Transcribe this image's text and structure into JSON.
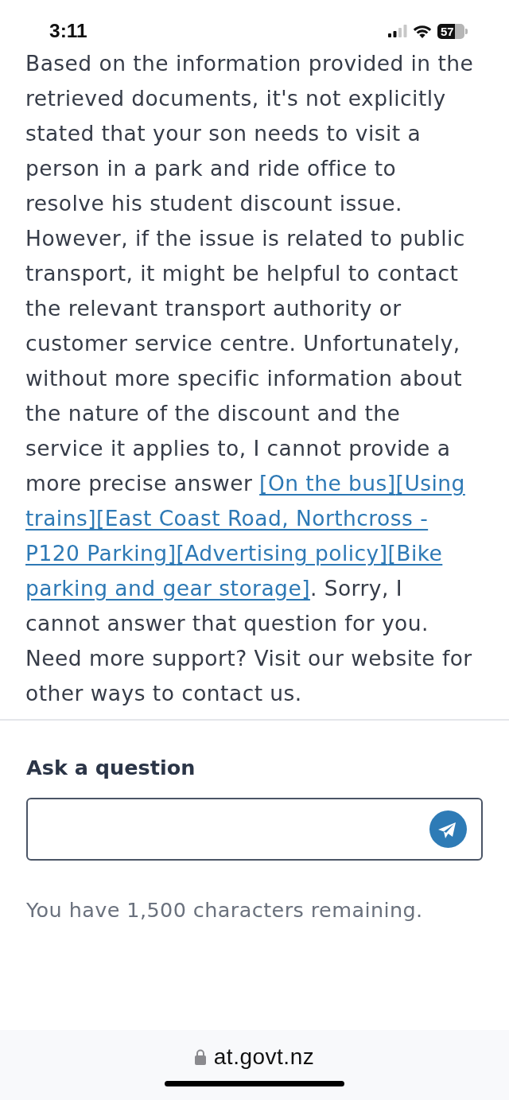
{
  "status_bar": {
    "time": "3:11",
    "battery": "57"
  },
  "answer": {
    "segments": [
      {
        "kind": "text",
        "text": "Based on the information provided in the retrieved documents, it's not explicitly stated that your son needs to visit a person in a park and ride office to resolve his student discount issue. However, if the issue is related to public transport, it might be helpful to contact the relevant transport authority or customer service centre. Unfortunately, without more specific information about the nature of the discount and the service it applies to, I cannot provide a more precise answer "
      },
      {
        "kind": "link",
        "parts": [
          "[On the bus]"
        ]
      },
      {
        "kind": "link",
        "parts": [
          "[Using",
          "trains]"
        ]
      },
      {
        "kind": "link",
        "parts": [
          "[East Coast Road, Northcross -",
          "P120 Parking]"
        ]
      },
      {
        "kind": "link",
        "parts": [
          "[Advertising policy]"
        ]
      },
      {
        "kind": "link",
        "parts": [
          "[Bike",
          "parking and gear storage]"
        ]
      },
      {
        "kind": "text",
        "text": ". Sorry, I cannot answer that question for you. Need more support? Visit our website for other ways to contact us."
      }
    ]
  },
  "question_form": {
    "label": "Ask a question",
    "counter": "You have 1,500 characters remaining."
  },
  "browser_bar": {
    "url": "at.govt.nz"
  }
}
